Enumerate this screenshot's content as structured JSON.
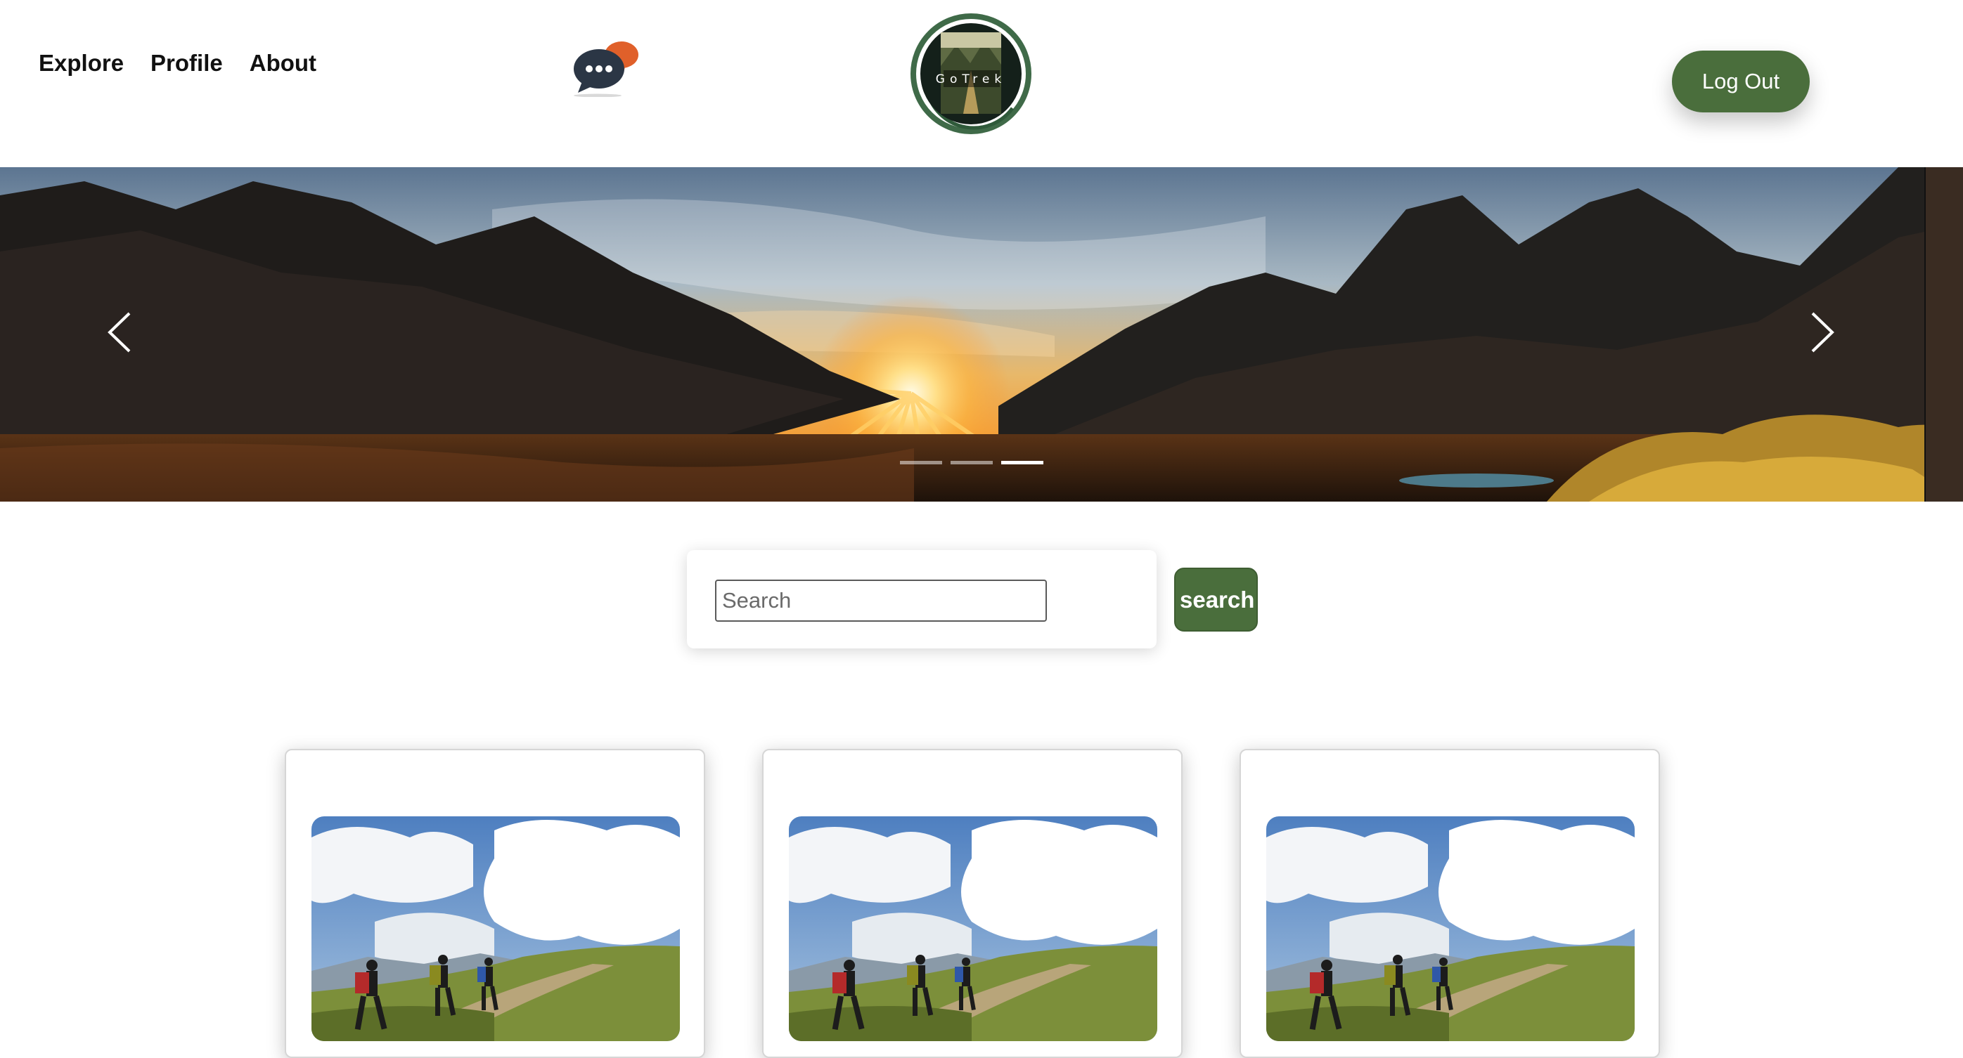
{
  "header": {
    "nav": {
      "explore": "Explore",
      "profile": "Profile",
      "about": "About"
    },
    "logo_text": "GoTrek",
    "logout_label": "Log Out"
  },
  "hero": {
    "slide_count": 3,
    "active_slide": 3
  },
  "search": {
    "placeholder": "Search",
    "value": "",
    "button_label": "search"
  },
  "cards": [
    {
      "image": "hikers-on-mountain-trail"
    },
    {
      "image": "hikers-on-mountain-trail"
    },
    {
      "image": "hikers-on-mountain-trail"
    }
  ],
  "colors": {
    "accent": "#4a6e3c",
    "chat_bubble_dark": "#2b3645",
    "chat_bubble_orange": "#e0602a"
  }
}
